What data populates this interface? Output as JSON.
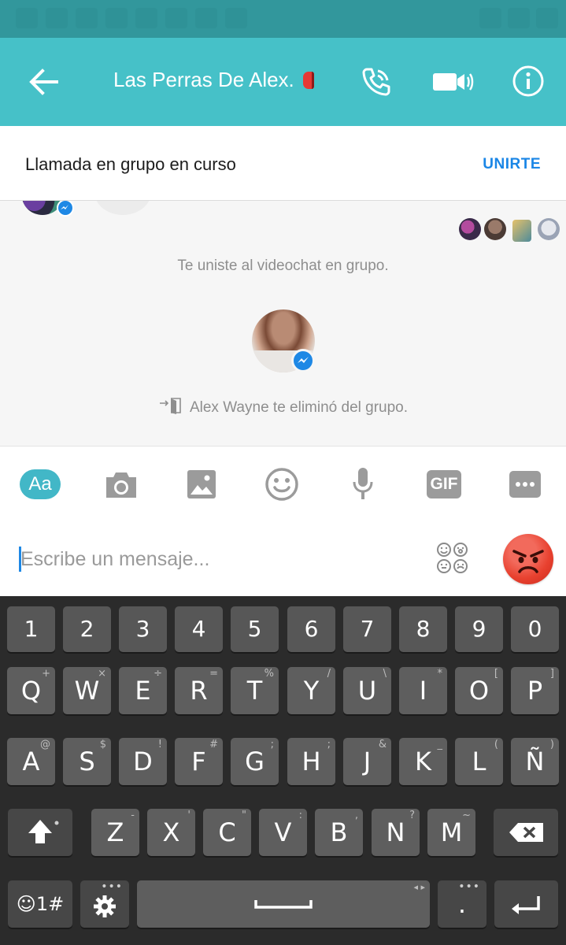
{
  "header": {
    "title": "Las Perras De Alex.",
    "back_icon": "arrow-left-icon",
    "call_icon": "phone-icon",
    "video_icon": "video-camera-icon",
    "info_icon": "info-icon"
  },
  "banner": {
    "text": "Llamada en grupo en curso",
    "join_label": "UNIRTE"
  },
  "chat": {
    "system_joined": "Te uniste al videochat en grupo.",
    "system_removed": "Alex Wayne te eliminó del grupo."
  },
  "toolbar": {
    "aa_label": "Aa",
    "gif_label": "GIF",
    "items": [
      "text-aa-icon",
      "camera-icon",
      "gallery-icon",
      "emoji-icon",
      "microphone-icon",
      "gif-icon",
      "more-icon"
    ]
  },
  "composer": {
    "placeholder": "Escribe un mensaje...",
    "emoji_icon": "emoji-grid-icon",
    "quick_reaction_icon": "angry-face-icon"
  },
  "keyboard": {
    "number_row": [
      "1",
      "2",
      "3",
      "4",
      "5",
      "6",
      "7",
      "8",
      "9",
      "0"
    ],
    "row1": [
      {
        "k": "Q",
        "h": "+"
      },
      {
        "k": "W",
        "h": "×"
      },
      {
        "k": "E",
        "h": "÷"
      },
      {
        "k": "R",
        "h": "="
      },
      {
        "k": "T",
        "h": "%"
      },
      {
        "k": "Y",
        "h": "/"
      },
      {
        "k": "U",
        "h": "\\"
      },
      {
        "k": "I",
        "h": "*"
      },
      {
        "k": "O",
        "h": "["
      },
      {
        "k": "P",
        "h": "]"
      }
    ],
    "row2": [
      {
        "k": "A",
        "h": "@"
      },
      {
        "k": "S",
        "h": "$"
      },
      {
        "k": "D",
        "h": "!"
      },
      {
        "k": "F",
        "h": "#"
      },
      {
        "k": "G",
        "h": ";"
      },
      {
        "k": "H",
        "h": ";"
      },
      {
        "k": "J",
        "h": "&"
      },
      {
        "k": "K",
        "h": "_"
      },
      {
        "k": "L",
        "h": "("
      },
      {
        "k": "Ñ",
        "h": ")"
      }
    ],
    "row3": [
      {
        "k": "Z",
        "h": "-"
      },
      {
        "k": "X",
        "h": "'"
      },
      {
        "k": "C",
        "h": "\""
      },
      {
        "k": "V",
        "h": ":"
      },
      {
        "k": "B",
        "h": ","
      },
      {
        "k": "N",
        "h": "?"
      },
      {
        "k": "M",
        "h": "~"
      }
    ],
    "symbols_label": "☺1#",
    "period_label": "."
  },
  "colors": {
    "status_bar": "#32979c",
    "header": "#46c1c8",
    "join_accent": "#1a86e6",
    "messenger_badge": "#1e88e5"
  }
}
